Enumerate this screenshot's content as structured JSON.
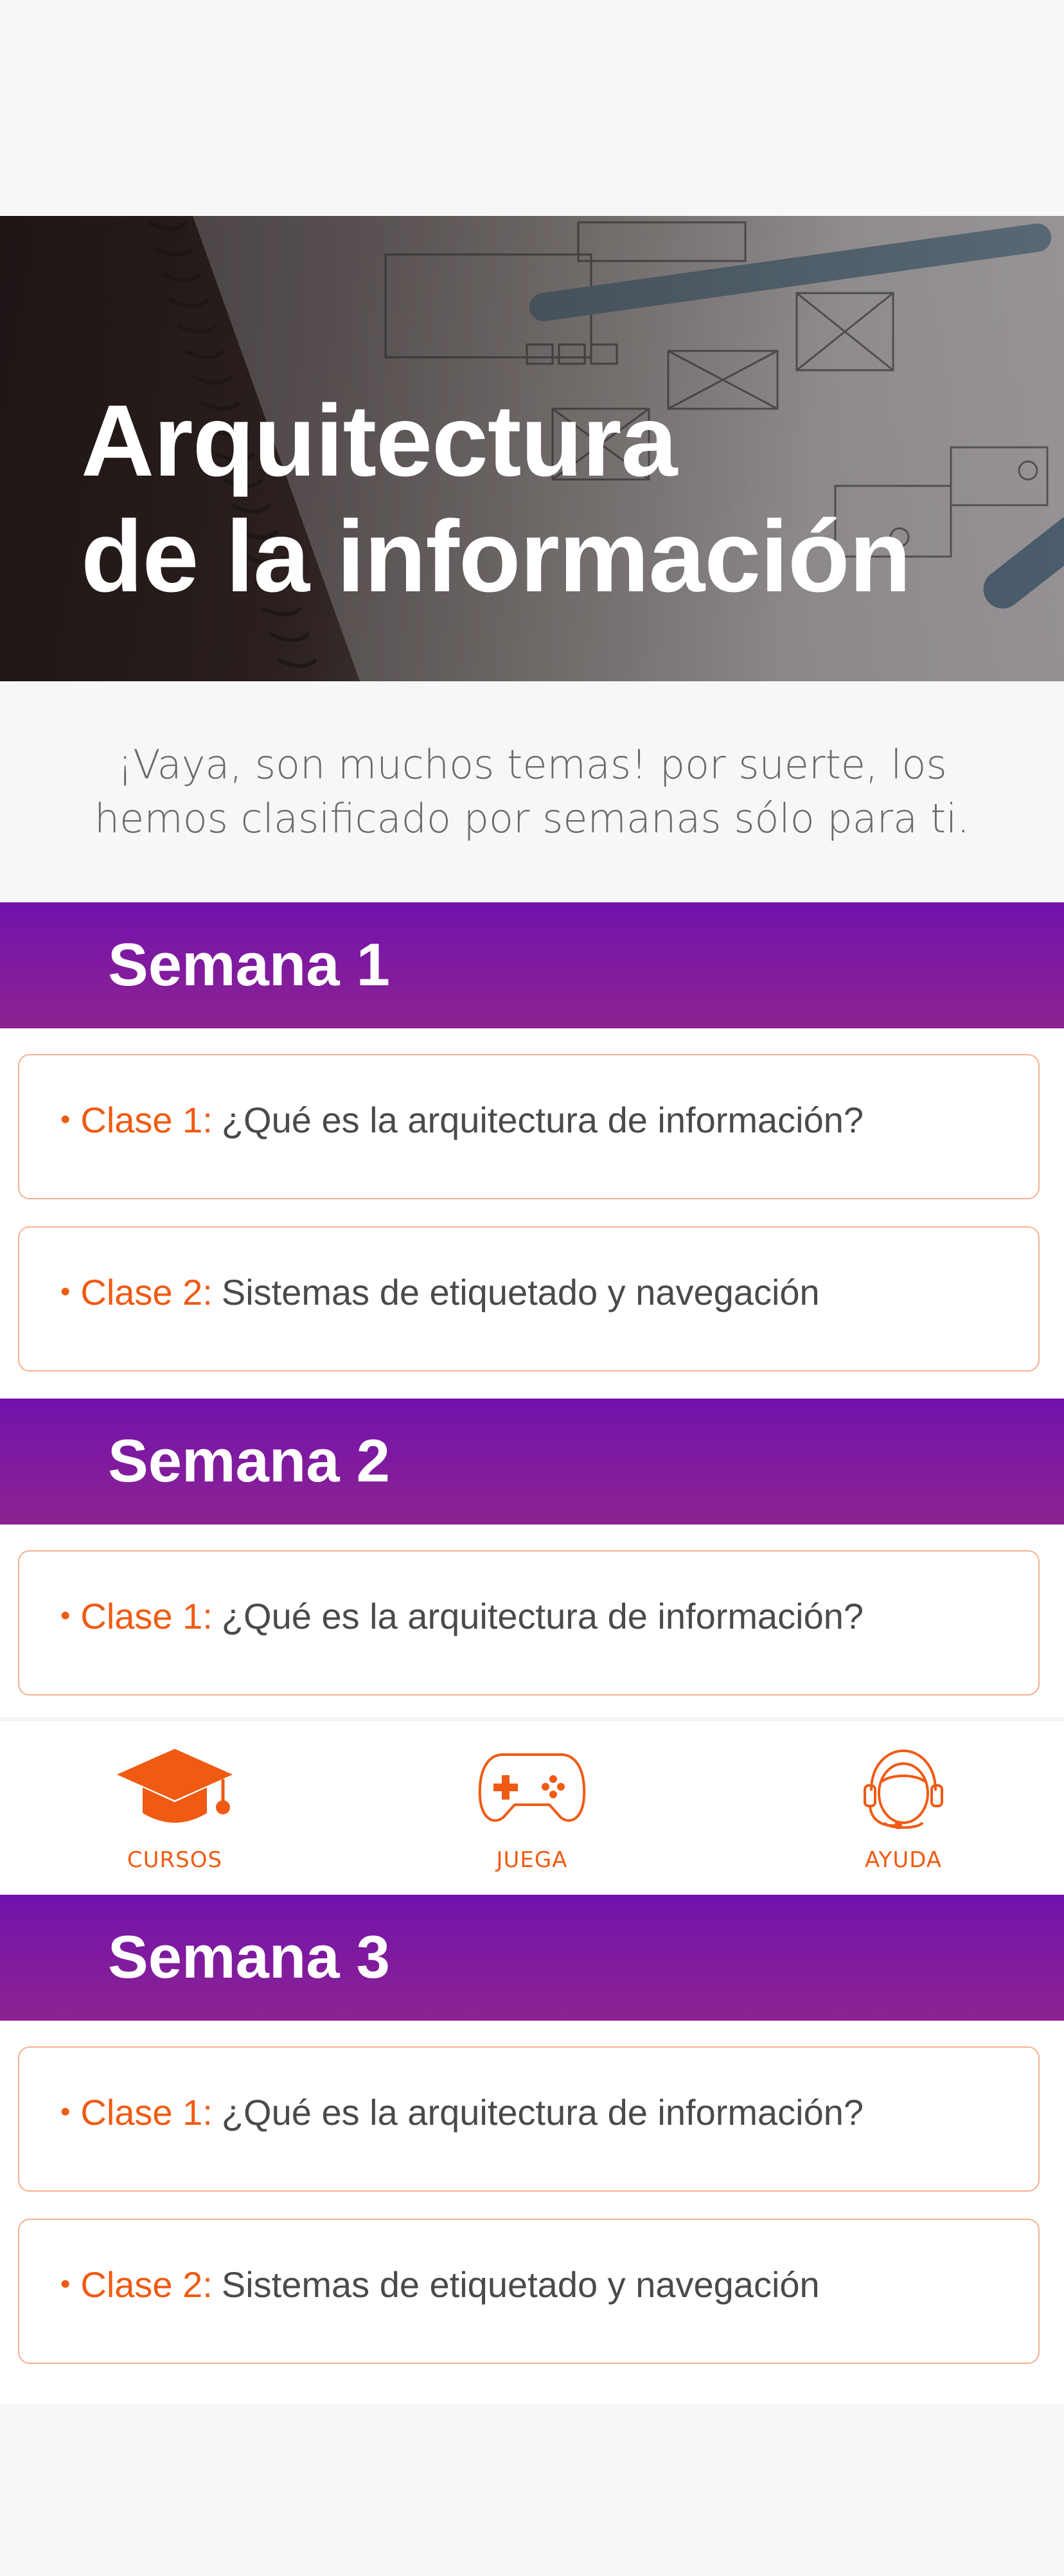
{
  "hero": {
    "title_line1": "Arquitectura",
    "title_line2": "de la información"
  },
  "intro": {
    "text": "¡Vaya, son muchos temas! por suerte, los hemos clasificado por semanas sólo para ti."
  },
  "weeks": [
    {
      "title": "Semana 1",
      "classes": [
        {
          "label": "Clase 1:",
          "topic": "¿Qué es la arquitectura de información?"
        },
        {
          "label": "Clase 2:",
          "topic": "Sistemas de etiquetado y navegación"
        }
      ]
    },
    {
      "title": "Semana 2",
      "classes": [
        {
          "label": "Clase 1:",
          "topic": "¿Qué es la arquitectura de información?"
        }
      ]
    },
    {
      "title": "Semana 3",
      "classes": [
        {
          "label": "Clase 1:",
          "topic": "¿Qué es la arquitectura de información?"
        },
        {
          "label": "Clase 2:",
          "topic": "Sistemas de etiquetado y navegación"
        }
      ]
    }
  ],
  "nav": {
    "items": [
      {
        "label": "CURSOS",
        "icon": "graduation-cap-icon"
      },
      {
        "label": "JUEGA",
        "icon": "gamepad-icon"
      },
      {
        "label": "AYUDA",
        "icon": "support-headset-icon"
      }
    ]
  },
  "colors": {
    "accent": "#f05a13",
    "card_border": "#f5b08c",
    "week_header_top": "#7212ad",
    "week_header_bottom": "#8d2391",
    "text": "#4a4a4a",
    "background": "#f7f7f7"
  }
}
